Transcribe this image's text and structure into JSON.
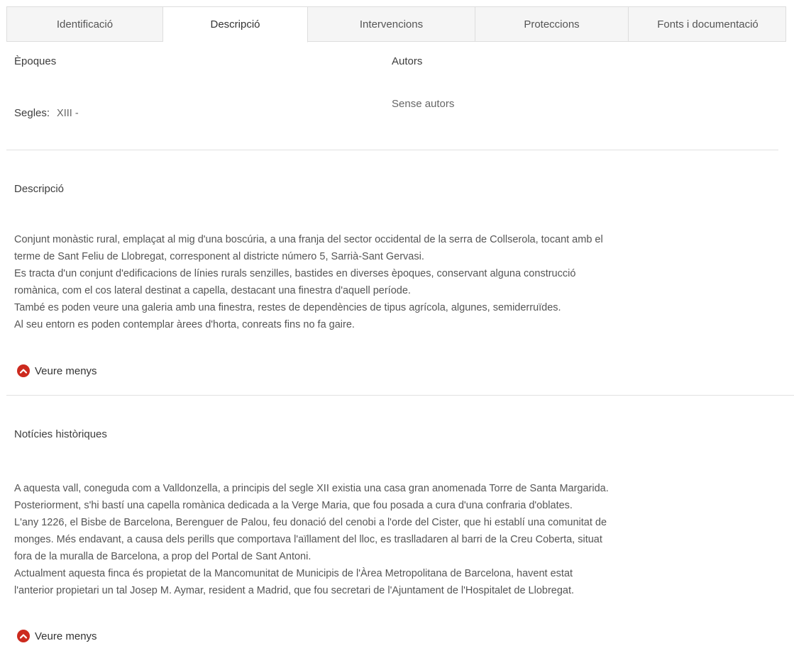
{
  "tabs": [
    {
      "label": "Identificació"
    },
    {
      "label": "Descripció"
    },
    {
      "label": "Intervencions"
    },
    {
      "label": "Proteccions"
    },
    {
      "label": "Fonts i documentació"
    }
  ],
  "epoques": {
    "heading": "Èpoques",
    "segles_label": "Segles:",
    "segles_value": "XIII -"
  },
  "autors": {
    "heading": "Autors",
    "value": "Sense autors"
  },
  "descripcio": {
    "heading": "Descripció",
    "lines": [
      "Conjunt monàstic rural, emplaçat al mig d'una boscúria, a una franja del sector occidental de la serra de Collserola, tocant amb el",
      "terme de Sant Feliu de Llobregat, corresponent al districte número 5, Sarrià-Sant Gervasi.",
      "Es tracta d'un conjunt d'edificacions de línies rurals senzilles, bastides en diverses èpoques, conservant alguna construcció",
      "romànica, com el cos lateral destinat a capella, destacant una finestra d'aquell període.",
      "També es poden veure una galeria amb una finestra, restes de dependències de tipus agrícola, algunes, semiderruïdes.",
      "Al seu entorn es poden contemplar àrees d'horta, conreats fins no fa gaire."
    ],
    "toggle_label": "Veure menys"
  },
  "noticies": {
    "heading": "Notícies històriques",
    "lines": [
      "A aquesta vall, coneguda com a Valldonzella, a principis del segle XII existia una casa gran anomenada Torre de Santa Margarida.",
      "Posteriorment, s'hi bastí una capella romànica dedicada a la Verge Maria, que fou posada a cura d'una confraria d'oblates.",
      "L'any 1226, el Bisbe de Barcelona, Berenguer de Palou, feu donació del cenobi a l'orde del Cister, que hi establí una comunitat de",
      "monges. Més endavant, a causa dels perills que comportava l'aïllament del lloc, es traslladaren al barri de la Creu Coberta, situat",
      "fora de la muralla de Barcelona, a prop del Portal de Sant Antoni.",
      "Actualment aquesta finca és propietat de la Mancomunitat de Municipis de l'Àrea Metropolitana de Barcelona, havent estat",
      "l'anterior propietari un tal Josep M. Aymar, resident a Madrid, que fou secretari de l'Ajuntament de l'Hospitalet de Llobregat."
    ],
    "toggle_label": "Veure menys"
  },
  "colors": {
    "accent": "#cc2a1e"
  },
  "icons": {
    "toggle": "chevron-up-circle-icon"
  }
}
